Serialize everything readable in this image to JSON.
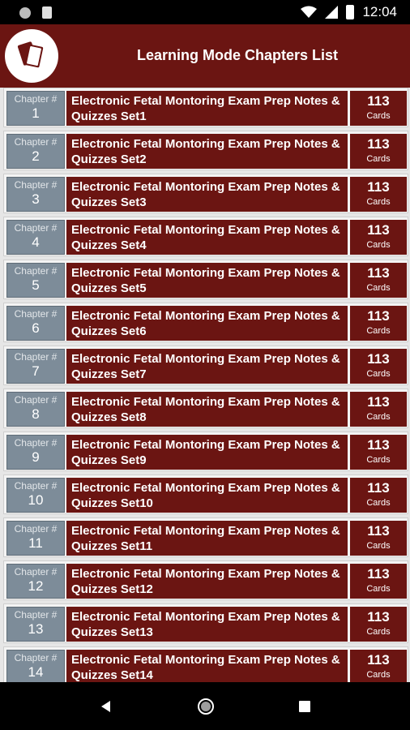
{
  "status": {
    "time": "12:04"
  },
  "header": {
    "title": "Learning Mode Chapters List",
    "logo_icon": "flashcards-icon"
  },
  "chapters": [
    {
      "label": "Chapter #",
      "number": "1",
      "title": "Electronic Fetal Montoring Exam Prep Notes & Quizzes Set1",
      "count": "113",
      "count_label": "Cards"
    },
    {
      "label": "Chapter #",
      "number": "2",
      "title": "Electronic Fetal Montoring Exam Prep Notes & Quizzes Set2",
      "count": "113",
      "count_label": "Cards"
    },
    {
      "label": "Chapter #",
      "number": "3",
      "title": "Electronic Fetal Montoring Exam Prep Notes & Quizzes Set3",
      "count": "113",
      "count_label": "Cards"
    },
    {
      "label": "Chapter #",
      "number": "4",
      "title": "Electronic Fetal Montoring Exam Prep Notes & Quizzes Set4",
      "count": "113",
      "count_label": "Cards"
    },
    {
      "label": "Chapter #",
      "number": "5",
      "title": "Electronic Fetal Montoring Exam Prep Notes & Quizzes Set5",
      "count": "113",
      "count_label": "Cards"
    },
    {
      "label": "Chapter #",
      "number": "6",
      "title": "Electronic Fetal Montoring Exam Prep Notes & Quizzes Set6",
      "count": "113",
      "count_label": "Cards"
    },
    {
      "label": "Chapter #",
      "number": "7",
      "title": "Electronic Fetal Montoring Exam Prep Notes & Quizzes Set7",
      "count": "113",
      "count_label": "Cards"
    },
    {
      "label": "Chapter #",
      "number": "8",
      "title": "Electronic Fetal Montoring Exam Prep Notes & Quizzes Set8",
      "count": "113",
      "count_label": "Cards"
    },
    {
      "label": "Chapter #",
      "number": "9",
      "title": "Electronic Fetal Montoring Exam Prep Notes & Quizzes Set9",
      "count": "113",
      "count_label": "Cards"
    },
    {
      "label": "Chapter #",
      "number": "10",
      "title": "Electronic Fetal Montoring Exam Prep Notes & Quizzes Set10",
      "count": "113",
      "count_label": "Cards"
    },
    {
      "label": "Chapter #",
      "number": "11",
      "title": "Electronic Fetal Montoring Exam Prep Notes & Quizzes Set11",
      "count": "113",
      "count_label": "Cards"
    },
    {
      "label": "Chapter #",
      "number": "12",
      "title": "Electronic Fetal Montoring Exam Prep Notes & Quizzes Set12",
      "count": "113",
      "count_label": "Cards"
    },
    {
      "label": "Chapter #",
      "number": "13",
      "title": "Electronic Fetal Montoring Exam Prep Notes & Quizzes Set13",
      "count": "113",
      "count_label": "Cards"
    },
    {
      "label": "Chapter #",
      "number": "14",
      "title": "Electronic Fetal Montoring Exam Prep Notes & Quizzes Set14",
      "count": "113",
      "count_label": "Cards"
    }
  ],
  "nav": {
    "back_icon": "back-icon",
    "home_icon": "home-icon",
    "recents_icon": "recents-icon"
  },
  "colors": {
    "primary": "#6b1512",
    "chapter_box": "#7d8c99",
    "background": "#e6e6e6"
  }
}
